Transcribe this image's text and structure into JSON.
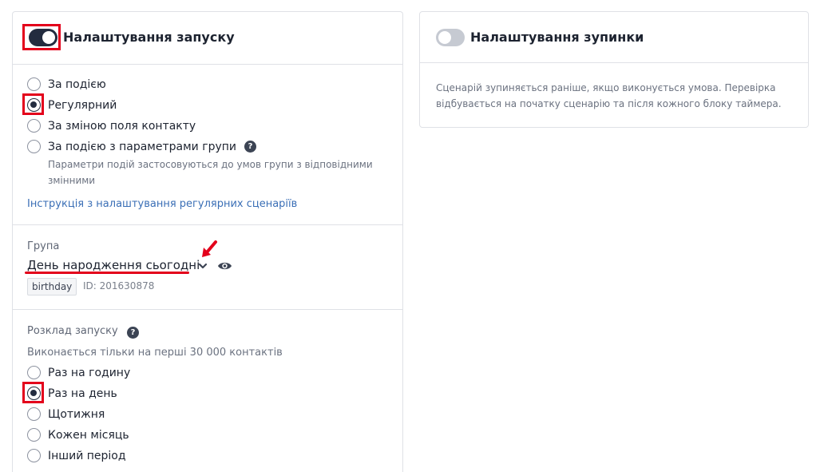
{
  "start_settings": {
    "title": "Налаштування запуску",
    "enabled": true,
    "trigger_options": [
      {
        "label": "За подією",
        "checked": false
      },
      {
        "label": "Регулярний",
        "checked": true
      },
      {
        "label": "За зміною поля контакту",
        "checked": false
      },
      {
        "label": "За подією з параметрами групи",
        "checked": false
      }
    ],
    "group_params_hint_line1": "Параметри подій застосовуються до умов групи з відповідними",
    "group_params_hint_line2": "змінними",
    "instruction_link": "Інструкція з налаштування регулярних сценаріїв",
    "group": {
      "label": "Група",
      "selected": "День народження сьогодні",
      "tag": "birthday",
      "id_text": "ID: 201630878"
    },
    "schedule": {
      "label": "Розклад запуску",
      "hint": "Виконається тільки на перші 30 000 контактів",
      "options": [
        {
          "label": "Раз на годину",
          "checked": false
        },
        {
          "label": "Раз на день",
          "checked": true
        },
        {
          "label": "Щотижня",
          "checked": false
        },
        {
          "label": "Кожен місяць",
          "checked": false
        },
        {
          "label": "Інший період",
          "checked": false
        }
      ]
    }
  },
  "stop_settings": {
    "title": "Налаштування зупинки",
    "enabled": false,
    "description_line1": "Сценарій зупиняється раніше, якщо виконується умова. Перевірка",
    "description_line2": "відбувається на початку сценарію та після кожного блоку таймера."
  },
  "icons": {
    "help": "question-circle-icon",
    "dropdown": "chevron-down-icon",
    "preview": "eye-icon",
    "annotation_arrow": "red-arrow-icon"
  },
  "colors": {
    "accent_dark": "#232c3f",
    "link": "#3b6fb6",
    "annotation": "#e3001b",
    "toggle_off": "#c6cad2"
  }
}
